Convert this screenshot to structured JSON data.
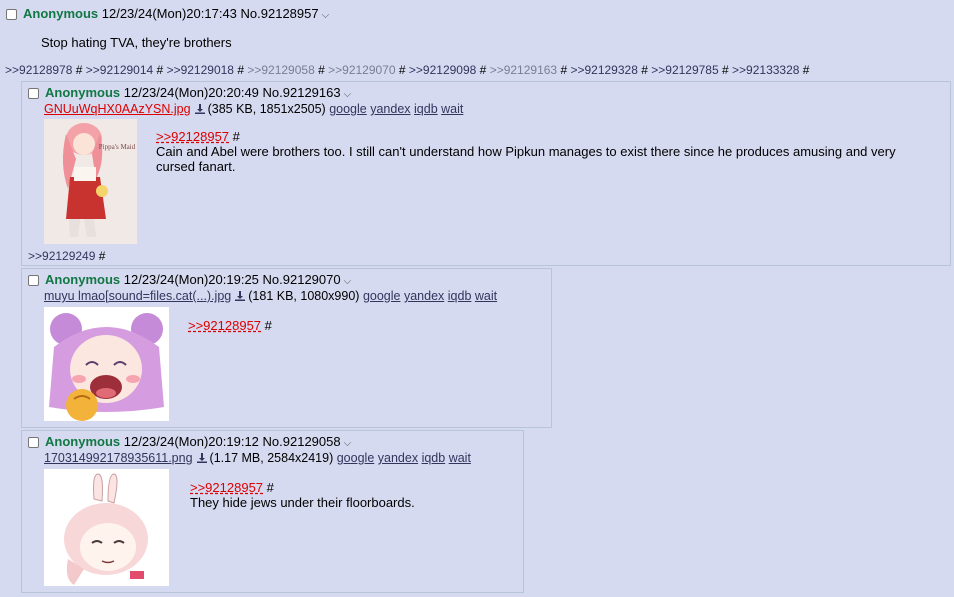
{
  "op": {
    "name": "Anonymous",
    "datetime": "12/23/24(Mon)20:17:43",
    "number": "No.92128957",
    "message": "Stop hating TVA, they're brothers"
  },
  "backlinks": [
    {
      "text": ">>92128978",
      "dim": false
    },
    {
      "text": ">>92129014",
      "dim": false
    },
    {
      "text": ">>92129018",
      "dim": false
    },
    {
      "text": ">>92129058",
      "dim": true
    },
    {
      "text": ">>92129070",
      "dim": true
    },
    {
      "text": ">>92129098",
      "dim": false
    },
    {
      "text": ">>92129163",
      "dim": true
    },
    {
      "text": ">>92129328",
      "dim": false
    },
    {
      "text": ">>92129785",
      "dim": false
    },
    {
      "text": ">>92133328",
      "dim": false
    }
  ],
  "hash": "#",
  "chevron": "⌵",
  "file_actions": [
    "google",
    "yandex",
    "iqdb",
    "wait"
  ],
  "replies": [
    {
      "name": "Anonymous",
      "datetime": "12/23/24(Mon)20:20:49",
      "number": "No.92129163",
      "filename": "GNUuWqHX0AAzYSN.jpg",
      "fileinfo": "(385 KB, 1851x2505)",
      "quote": ">>92128957",
      "text": "Cain and Abel were brothers too. I still can't understand how Pipkun manages to exist there since he produces amusing and very cursed fanart.",
      "reply_link": ">>92129249",
      "thumb_text": "Pippa's Maid"
    },
    {
      "name": "Anonymous",
      "datetime": "12/23/24(Mon)20:19:25",
      "number": "No.92129070",
      "filename": "muyu lmao[sound=files.cat(...).jpg",
      "fileinfo": "(181 KB, 1080x990)",
      "quote": ">>92128957",
      "text": ""
    },
    {
      "name": "Anonymous",
      "datetime": "12/23/24(Mon)20:19:12",
      "number": "No.92129058",
      "filename": "1703149921789356​11.png",
      "fileinfo": "(1.17 MB, 2584x2419)",
      "quote": ">>92128957",
      "text": "They hide jews under their floorboards."
    }
  ]
}
